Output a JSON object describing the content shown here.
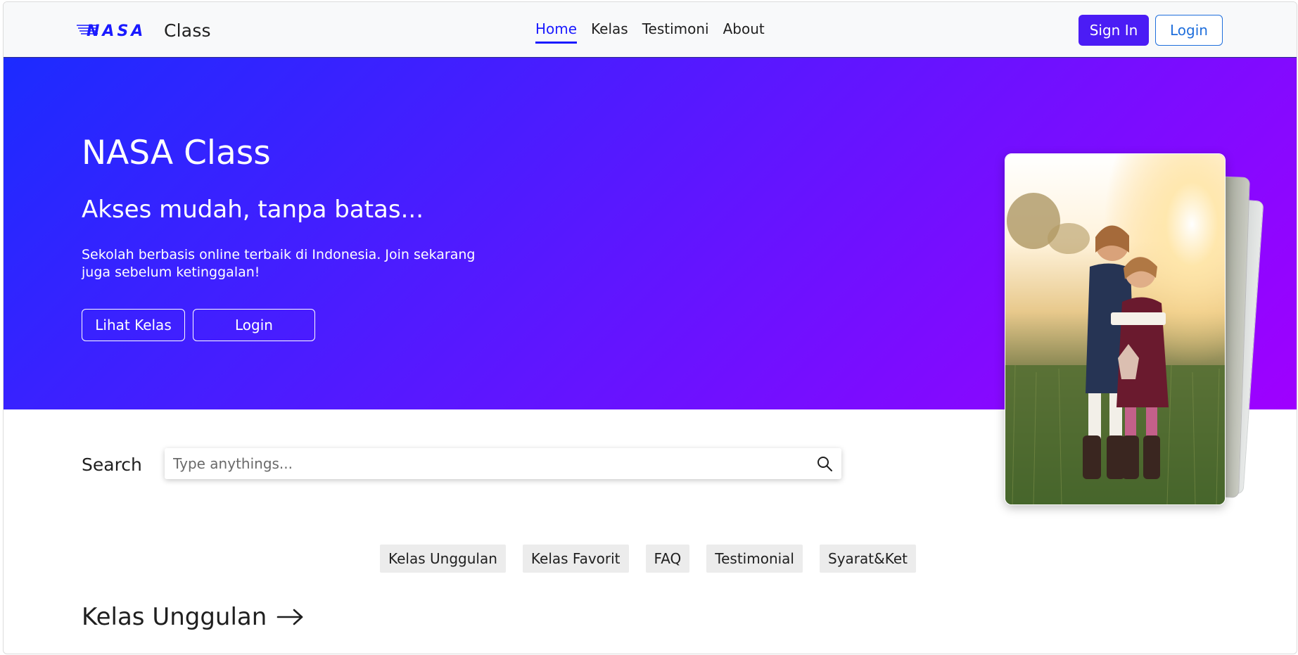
{
  "navbar": {
    "brand_logo_text": "NASA",
    "brand_text": "Class",
    "links": [
      {
        "label": "Home",
        "active": true
      },
      {
        "label": "Kelas",
        "active": false
      },
      {
        "label": "Testimoni",
        "active": false
      },
      {
        "label": "About",
        "active": false
      }
    ],
    "signin_label": "Sign In",
    "login_label": "Login"
  },
  "hero": {
    "title": "NASA Class",
    "subtitle": "Akses mudah, tanpa batas...",
    "description": "Sekolah berbasis online terbaik di Indonesia. Join sekarang juga sebelum ketinggalan!",
    "buttons": {
      "lihat_kelas": "Lihat Kelas",
      "login": "Login"
    }
  },
  "search": {
    "label": "Search",
    "placeholder": "Type anythings...",
    "value": ""
  },
  "categories": [
    "Kelas Unggulan",
    "Kelas Favorit",
    "FAQ",
    "Testimonial",
    "Syarat&Ket"
  ],
  "section": {
    "heading": "Kelas Unggulan"
  },
  "colors": {
    "gradient_start": "#1c2bff",
    "gradient_end": "#9f00ff",
    "accent_blue": "#1a1aff",
    "signin_bg": "#4b1cf5",
    "login_border": "#1f6fdc"
  },
  "icons": {
    "search": "search-icon",
    "arrow": "arrow-right-icon"
  }
}
